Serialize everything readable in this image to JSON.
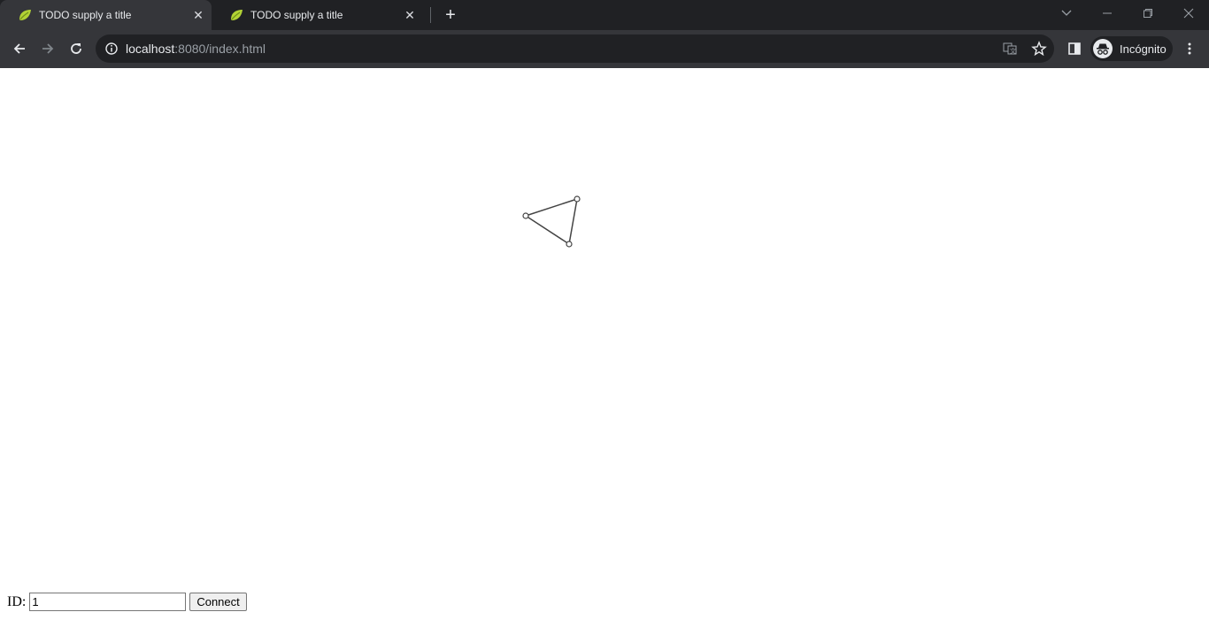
{
  "browser": {
    "tabs": [
      {
        "title": "TODO supply a title",
        "active": true
      },
      {
        "title": "TODO supply a title",
        "active": false
      }
    ],
    "url_host": "localhost",
    "url_rest": ":8080/index.html",
    "profile_label": "Incógnito"
  },
  "page": {
    "id_label": "ID:",
    "id_value": "1",
    "connect_label": "Connect",
    "shape_color": "#444444"
  }
}
